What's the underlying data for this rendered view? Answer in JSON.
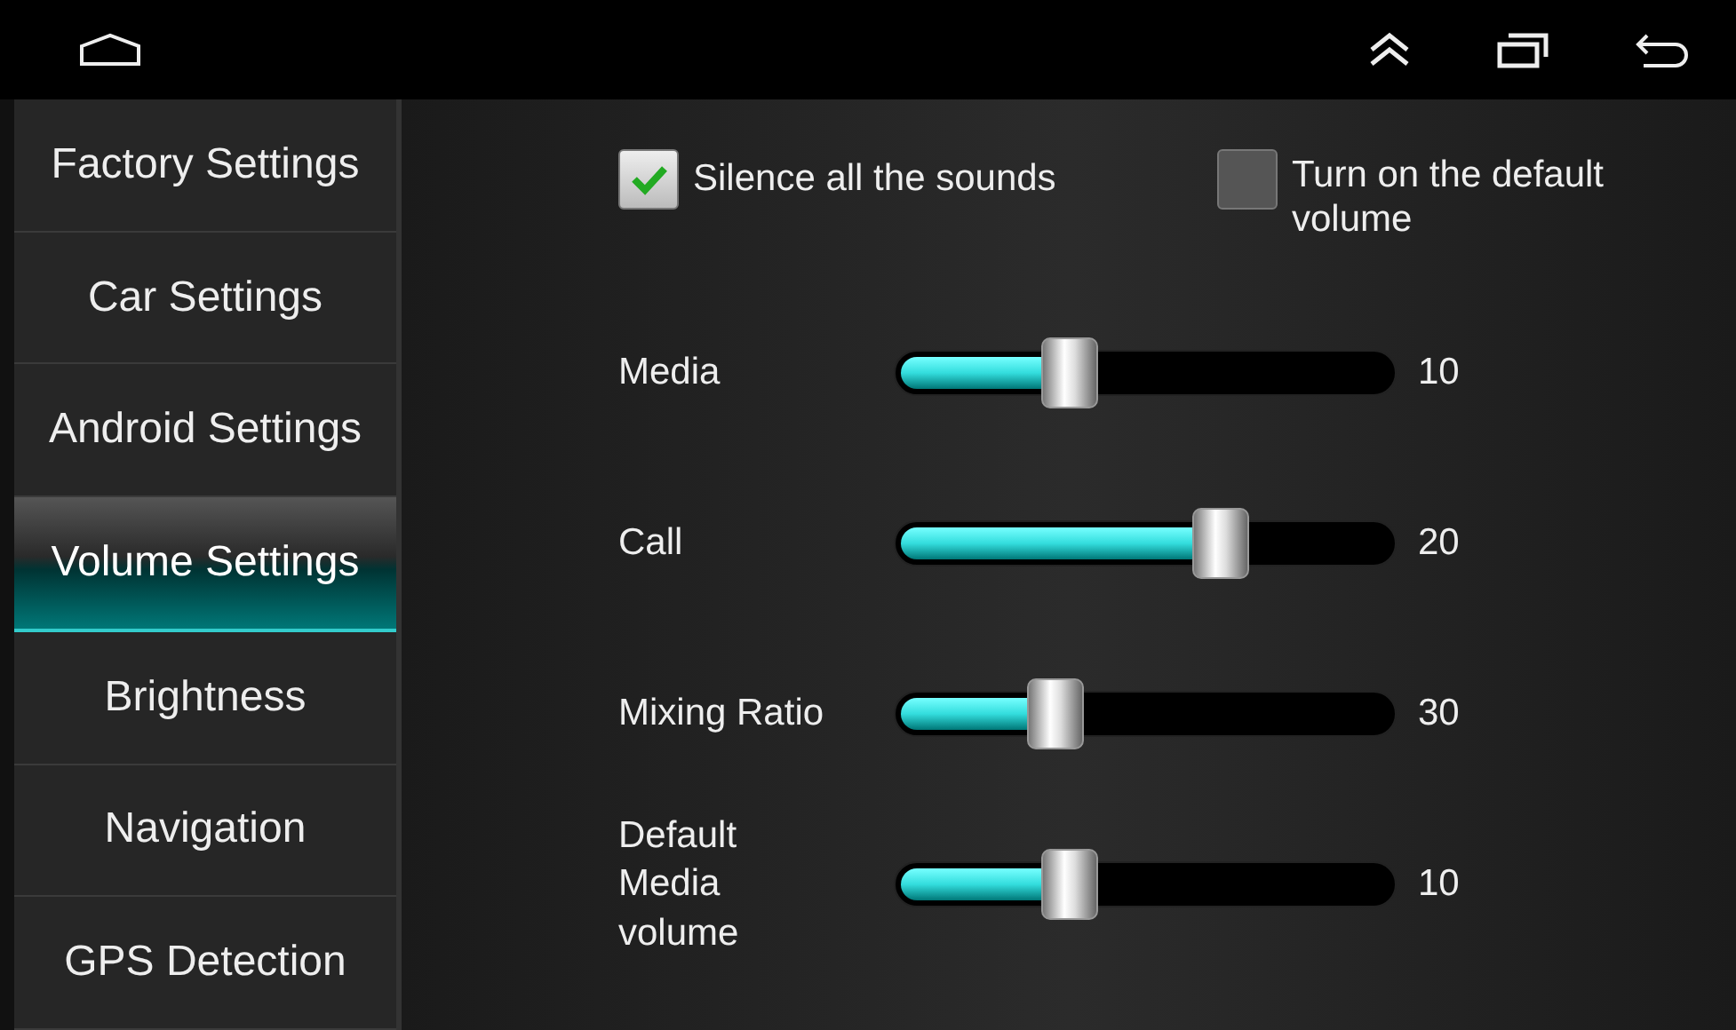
{
  "status_bar": {
    "buttons": [
      {
        "kind": "home"
      },
      {
        "kind": "up"
      },
      {
        "kind": "recents"
      },
      {
        "kind": "back"
      }
    ]
  },
  "sidebar": {
    "items": [
      {
        "label": "Factory Settings",
        "selected": false
      },
      {
        "label": "Car Settings",
        "selected": false
      },
      {
        "label": "Android Settings",
        "selected": false
      },
      {
        "label": "Volume Settings",
        "selected": true
      },
      {
        "label": "Brightness",
        "selected": false
      },
      {
        "label": "Navigation",
        "selected": false
      },
      {
        "label": "GPS Detection",
        "selected": false
      }
    ]
  },
  "options": [
    {
      "label": "Silence all the sounds",
      "checked": true
    },
    {
      "label": "Turn on the default volume",
      "checked": false
    }
  ],
  "sliders": [
    {
      "label": "Media",
      "level": 0.35,
      "reading": "10"
    },
    {
      "label": "Call",
      "level": 0.65,
      "reading": "20"
    },
    {
      "label": "Mixing Ratio",
      "level": 0.32,
      "reading": "30"
    },
    {
      "label": "Default Media volume",
      "level": 0.35,
      "reading": "10"
    }
  ]
}
